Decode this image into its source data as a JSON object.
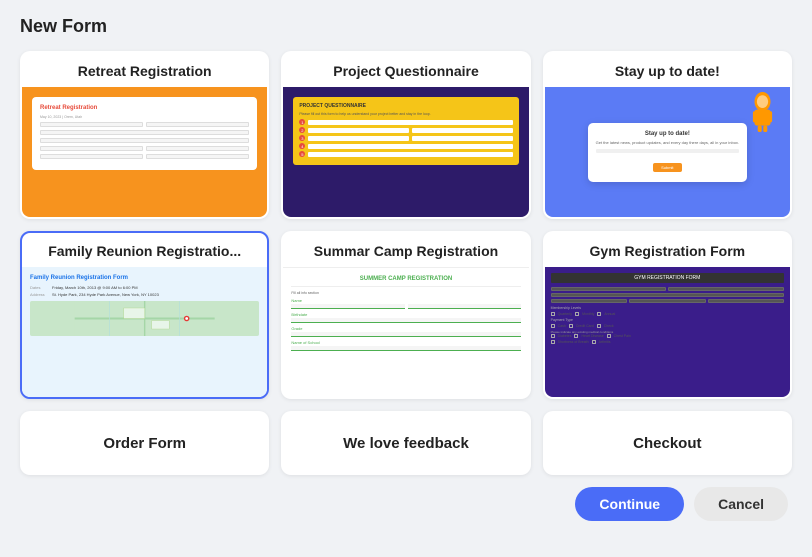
{
  "header": {
    "title": "New Form"
  },
  "cards": {
    "row1": [
      {
        "id": "retreat-registration",
        "label": "Retreat Registration",
        "preview_type": "orange",
        "selected": false
      },
      {
        "id": "project-questionnaire",
        "label": "Project Questionnaire",
        "preview_type": "purple",
        "selected": false
      },
      {
        "id": "stay-up-to-date",
        "label": "Stay up to date!",
        "preview_type": "blue",
        "selected": false
      }
    ],
    "row2": [
      {
        "id": "family-reunion",
        "label": "Family Reunion Registratio...",
        "preview_type": "lightblue",
        "selected": true
      },
      {
        "id": "summer-camp",
        "label": "Summar Camp Registration",
        "preview_type": "white",
        "selected": false
      },
      {
        "id": "gym-registration",
        "label": "Gym Registration Form",
        "preview_type": "darkpurple",
        "selected": false
      }
    ],
    "row3": [
      {
        "id": "order-form",
        "label": "Order Form"
      },
      {
        "id": "we-love-feedback",
        "label": "We love feedback"
      },
      {
        "id": "checkout",
        "label": "Checkout"
      }
    ]
  },
  "footer": {
    "continue_label": "Continue",
    "cancel_label": "Cancel"
  }
}
